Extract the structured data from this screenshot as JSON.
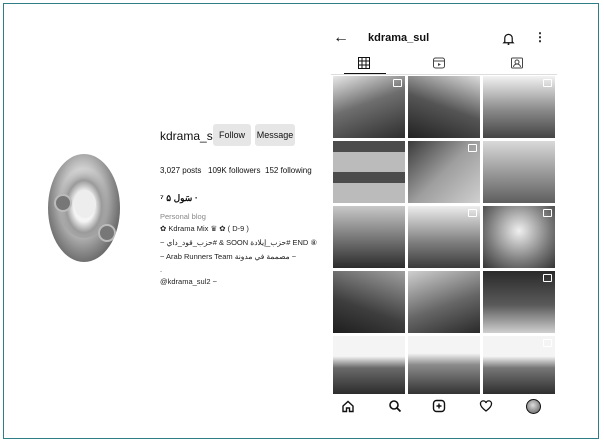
{
  "desktop": {
    "username": "kdrama_sul",
    "follow_label": "Follow",
    "message_label": "Message",
    "posts": "3,027 posts",
    "followers": "109K followers",
    "following": "152 following",
    "display_name": "سَول ۵ ⁷ ·",
    "category": "Personal blog",
    "bio_lines": [
      "✿ Kdrama Mix ♛ ✿ ( D-9 )",
      "~ حزب_قود_داي# & SOON حزب_إيلادة# END ⑧",
      "~ Arab Runners Team مصممة في مدونة ~",
      ".",
      "@kdrama_sul2 ~"
    ]
  },
  "mobile": {
    "username": "kdrama_sul",
    "icons": {
      "back": "back-arrow-icon",
      "bell": "bell-icon",
      "more": "more-options-icon",
      "grid": "grid-icon",
      "reels": "reels-icon",
      "tagged": "tagged-icon",
      "home": "home-icon",
      "search": "search-icon",
      "create": "create-post-icon",
      "activity": "heart-icon",
      "profile": "profile-avatar"
    }
  },
  "colors": {
    "frame": "#2f7e86",
    "button": "#e6e6e6",
    "text": "#111111"
  }
}
